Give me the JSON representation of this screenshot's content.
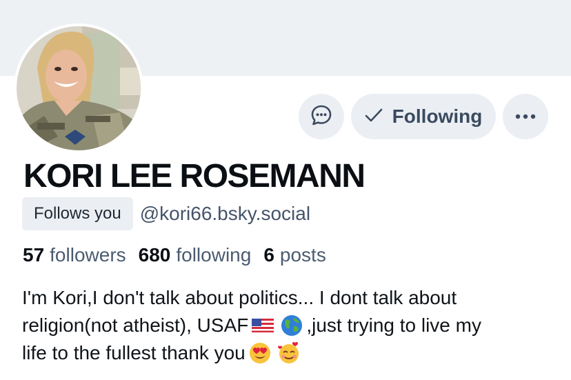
{
  "profile": {
    "display_name": "KORI LEE ROSEMANN",
    "follows_you_badge": "Follows you",
    "handle": "@kori66.bsky.social",
    "avatar_alt": "avatar",
    "stats": {
      "followers_count": "57",
      "followers_label": "followers",
      "following_count": "680",
      "following_label": "following",
      "posts_count": "6",
      "posts_label": "posts"
    },
    "bio": {
      "line1": "I'm Kori,I don't talk about politics... I dont talk about",
      "line2_a": "religion(not atheist), USAF",
      "line2_b": ",just trying to live my",
      "line3": "life to the fullest thank you"
    }
  },
  "actions": {
    "message_icon": "chat-bubble-icon",
    "following_label": "Following",
    "following_icon": "checkmark-icon",
    "more_icon": "ellipsis-icon"
  },
  "colors": {
    "banner": "#edf1f4",
    "button_bg": "#ebeff3",
    "muted_text": "#4b5b70"
  }
}
